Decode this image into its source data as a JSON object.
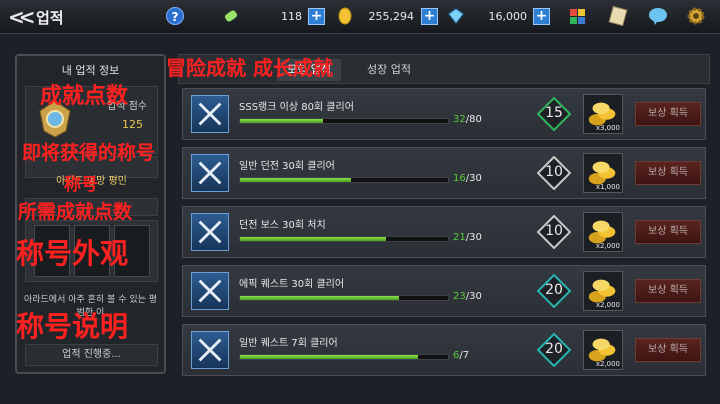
{
  "header": {
    "back_icon": "double-chevron-left-icon",
    "title": "업적",
    "help_label": "?",
    "stamina": "118",
    "gold": "255,294",
    "gems": "16,000"
  },
  "left_panel": {
    "title": "내 업적 정보",
    "points_label": "업적 점수",
    "points_value": "125",
    "title_name": "아라드 명망 평민",
    "description": "아라드에서 아주 흔히 볼 수 있는 평범한 이",
    "progress_button": "업적 진행중..."
  },
  "tabs": [
    {
      "label": "모험 업적"
    },
    {
      "label": "성장 업적"
    }
  ],
  "rows": [
    {
      "name": "SSS랭크 이상 80회 클리어",
      "current": "32",
      "total": "80",
      "points": "15",
      "reward_qty": "x3,000",
      "claim": "보상 획득",
      "accent": "#2fb65a"
    },
    {
      "name": "일반 던전 30회 클리어",
      "current": "16",
      "total": "30",
      "points": "10",
      "reward_qty": "x1,000",
      "claim": "보상 획득",
      "accent": "#c8c8c8"
    },
    {
      "name": "던전 보스 30회 처치",
      "current": "21",
      "total": "30",
      "points": "10",
      "reward_qty": "x2,000",
      "claim": "보상 획득",
      "accent": "#c8c8c8"
    },
    {
      "name": "에픽 퀘스트 30회 클리어",
      "current": "23",
      "total": "30",
      "points": "20",
      "reward_qty": "x2,000",
      "claim": "보상 획득",
      "accent": "#2ab3b0"
    },
    {
      "name": "일반 퀘스트 7회 클리어",
      "current": "6",
      "total": "7",
      "points": "20",
      "reward_qty": "x2,000",
      "claim": "보상 획득",
      "accent": "#2ab3b0"
    }
  ],
  "annotations": {
    "tabs": "冒险成就 成长成就",
    "points": "成就点数",
    "title_obtain": "即将获得的称号",
    "title": "称号",
    "required_points": "所需成就点数",
    "appearance": "称号外观",
    "description": "称号说明"
  }
}
